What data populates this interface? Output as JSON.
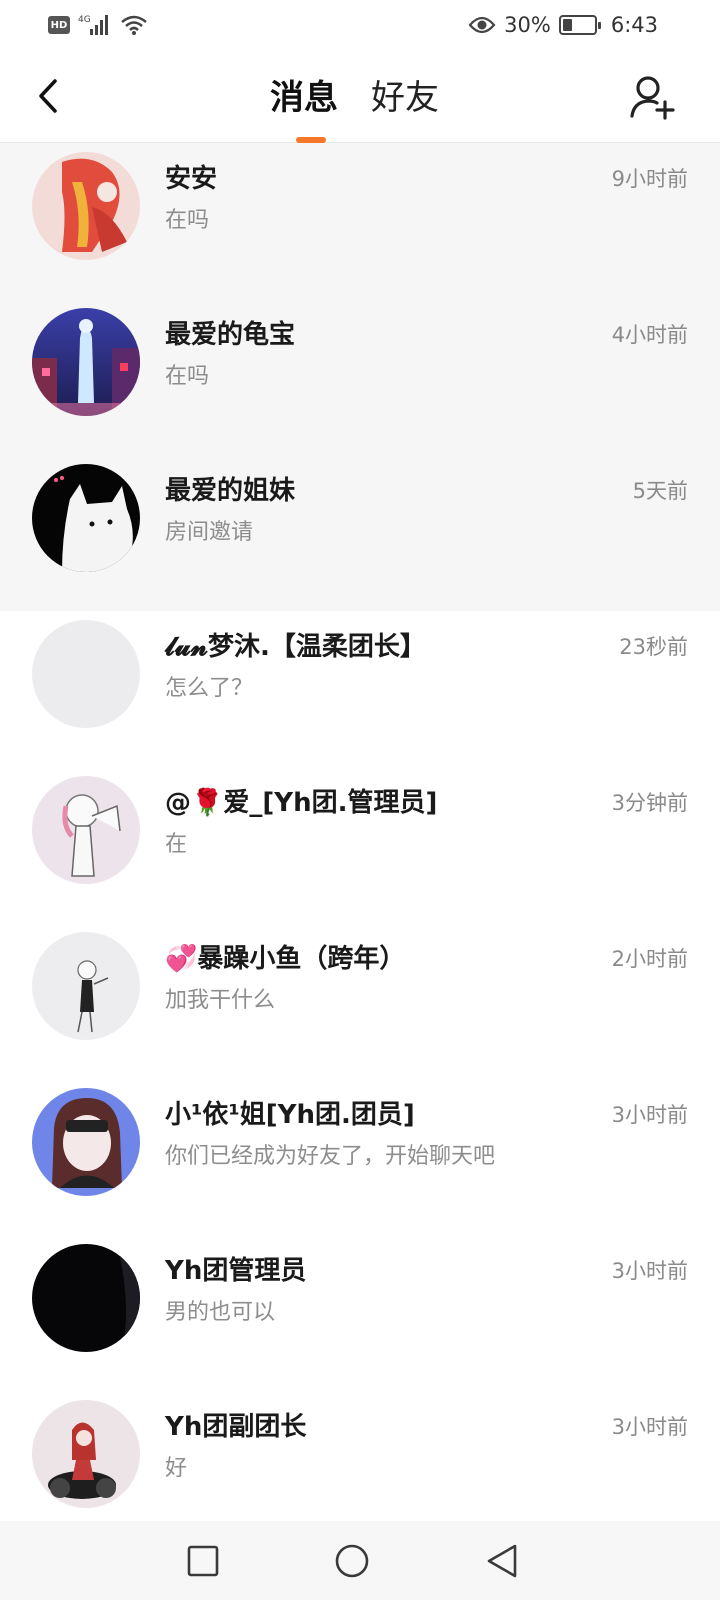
{
  "status_bar": {
    "left_icons": [
      "hd-icon",
      "4g-signal-icon",
      "wifi-icon"
    ],
    "hd_label": "HD",
    "network_label": "4G",
    "battery_percent": "30%",
    "battery_level": 0.3,
    "time": "6:43",
    "right_icons": [
      "eye-icon",
      "battery-icon"
    ]
  },
  "header": {
    "back_icon": "chevron-left-icon",
    "tabs": [
      {
        "label": "消息",
        "active": true
      },
      {
        "label": "好友",
        "active": false
      }
    ],
    "accent_color": "#f5772a",
    "add_friend_icon": "add-user-icon"
  },
  "conversations": [
    {
      "name": "安安",
      "time": "9小时前",
      "message": "在吗",
      "pinned": true
    },
    {
      "name": "最爱的龟宝",
      "time": "4小时前",
      "message": "在吗",
      "pinned": true
    },
    {
      "name": "最爱的姐妹",
      "time": "5天前",
      "message": "房间邀请",
      "pinned": true
    },
    {
      "name": "𝓵𝓾𝓷梦沐.【温柔团长】",
      "time": "23秒前",
      "message": "怎么了？",
      "pinned": false
    },
    {
      "name": "@🌹爱_[Yh团.管理员]",
      "time": "3分钟前",
      "message": "在",
      "pinned": false
    },
    {
      "name": "💞暴躁小鱼（跨年）",
      "time": "2小时前",
      "message": "加我干什么",
      "pinned": false
    },
    {
      "name": "小¹依¹姐[Yh团.团员]",
      "time": "3小时前",
      "message": "你们已经成为好友了，开始聊天吧",
      "pinned": false
    },
    {
      "name": "Yh团管理员",
      "time": "3小时前",
      "message": "男的也可以",
      "pinned": false
    },
    {
      "name": "Yh团副团长",
      "time": "3小时前",
      "message": "好",
      "pinned": false
    }
  ],
  "nav_bar": {
    "buttons": [
      "recents-square-icon",
      "home-circle-icon",
      "back-triangle-icon"
    ]
  }
}
